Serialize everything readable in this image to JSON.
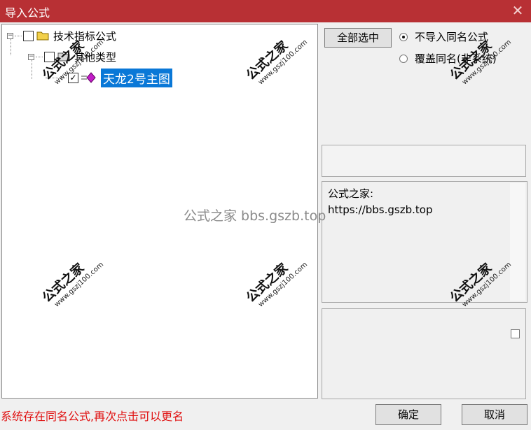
{
  "window": {
    "title": "导入公式",
    "close_glyph": "✕"
  },
  "tree": {
    "root": {
      "label": "技术指标公式",
      "expander": "⊟",
      "checked": false
    },
    "group": {
      "label": "其他类型",
      "expander": "⊟",
      "checked": false
    },
    "item": {
      "label": "天龙2号主图",
      "checked": true
    }
  },
  "controls": {
    "select_all_label": "全部选中",
    "radio_options": [
      {
        "label": "不导入同名公式",
        "selected": true
      },
      {
        "label": "覆盖同名(非系统)",
        "selected": false
      }
    ]
  },
  "info": {
    "line1": "公式之家:",
    "line2": "https://bbs.gszb.top"
  },
  "status_text": "系统存在同名公式,再次点击可以更名",
  "buttons": {
    "ok": "确定",
    "cancel": "取消"
  },
  "watermark": {
    "center_text": "公式之家 bbs.gszb.top",
    "stamp_cn": "公式之家",
    "stamp_url": "www.gszj100.com"
  },
  "colors": {
    "titlebar": "#b83034",
    "selection": "#0a78d7",
    "status_text": "#e01010"
  }
}
